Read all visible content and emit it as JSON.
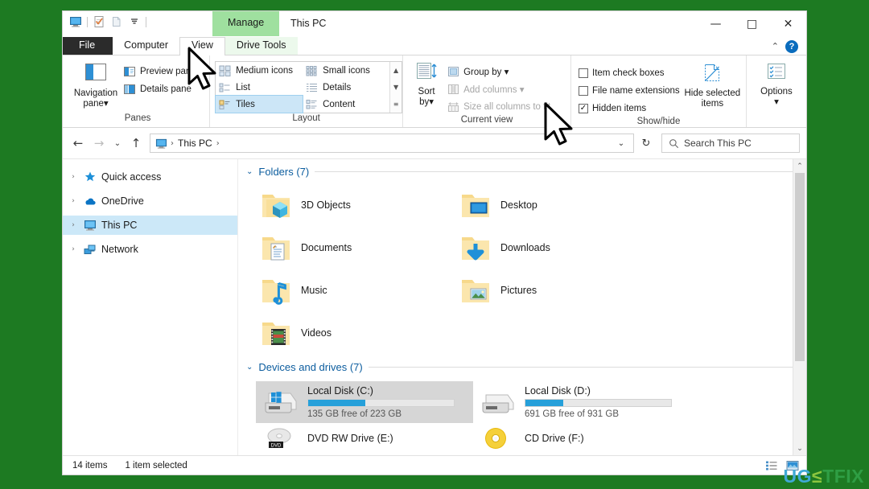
{
  "window": {
    "title": "This PC",
    "contextual_tab_title": "Manage",
    "controls": {
      "minimize": "—",
      "maximize": "□",
      "close": "✕"
    },
    "ribbon_collapse": "⌃",
    "help": "?"
  },
  "quick_access_toolbar": [
    {
      "name": "this-pc-icon"
    },
    {
      "name": "properties-icon"
    },
    {
      "name": "new-folder-icon"
    },
    {
      "name": "customize-dropdown-icon",
      "glyph": "☰"
    }
  ],
  "tabs": [
    {
      "id": "file",
      "label": "File"
    },
    {
      "id": "computer",
      "label": "Computer"
    },
    {
      "id": "view",
      "label": "View",
      "active": true
    },
    {
      "id": "drive-tools",
      "label": "Drive Tools",
      "contextual": true
    }
  ],
  "ribbon": {
    "groups": [
      {
        "id": "panes",
        "label": "Panes",
        "big_button": {
          "label_line1": "Navigation",
          "label_line2": "pane",
          "dropdown": "▾"
        },
        "items": [
          {
            "label": "Preview pane"
          },
          {
            "label": "Details pane"
          }
        ]
      },
      {
        "id": "layout",
        "label": "Layout",
        "gallery": [
          {
            "label": "Medium icons",
            "selected": false
          },
          {
            "label": "Small icons",
            "selected": false
          },
          {
            "label": "List",
            "selected": false
          },
          {
            "label": "Details",
            "selected": false
          },
          {
            "label": "Tiles",
            "selected": true
          },
          {
            "label": "Content",
            "selected": false
          }
        ],
        "scroll": {
          "up": "▲",
          "down": "▼",
          "more": "≡"
        }
      },
      {
        "id": "current-view",
        "label": "Current view",
        "items": [
          {
            "label": "Group by",
            "dropdown": "▾",
            "disabled": false
          },
          {
            "label": "Add columns",
            "dropdown": "▾",
            "disabled": true
          },
          {
            "label": "Size all columns to fit",
            "disabled": true
          }
        ],
        "sort_button": {
          "line1": "Sort",
          "line2": "by",
          "dropdown": "▾"
        }
      },
      {
        "id": "show-hide",
        "label": "Show/hide",
        "checkboxes": [
          {
            "label": "Item check boxes",
            "checked": false
          },
          {
            "label": "File name extensions",
            "checked": false
          },
          {
            "label": "Hidden items",
            "checked": true
          }
        ],
        "hide_selected": {
          "line1": "Hide selected",
          "line2": "items"
        }
      },
      {
        "id": "options",
        "label": "",
        "options_button": {
          "label": "Options",
          "dropdown": "▾"
        }
      }
    ]
  },
  "addressbar": {
    "back": "←",
    "forward": "→",
    "recent": "⌄",
    "up": "↑",
    "breadcrumbs": [
      "This PC"
    ],
    "separator": "›",
    "dropdown": "⌄",
    "refresh": "↻",
    "search_placeholder": "Search This PC",
    "search_value": ""
  },
  "navigation_pane": {
    "items": [
      {
        "label": "Quick access",
        "icon": "star-icon",
        "selected": false
      },
      {
        "label": "OneDrive",
        "icon": "cloud-icon",
        "selected": false
      },
      {
        "label": "This PC",
        "icon": "monitor-icon",
        "selected": true
      },
      {
        "label": "Network",
        "icon": "network-icon",
        "selected": false
      }
    ],
    "expander": "›"
  },
  "content": {
    "chevron": "⌄",
    "groups": [
      {
        "id": "folders",
        "title": "Folders (7)",
        "items": [
          {
            "name": "3D Objects",
            "icon": "folder-3d-objects-icon"
          },
          {
            "name": "Desktop",
            "icon": "folder-desktop-icon"
          },
          {
            "name": "Documents",
            "icon": "folder-documents-icon"
          },
          {
            "name": "Downloads",
            "icon": "folder-downloads-icon"
          },
          {
            "name": "Music",
            "icon": "folder-music-icon"
          },
          {
            "name": "Pictures",
            "icon": "folder-pictures-icon"
          },
          {
            "name": "Videos",
            "icon": "folder-videos-icon"
          }
        ]
      },
      {
        "id": "devices-and-drives",
        "title": "Devices and drives (7)",
        "drives": [
          {
            "name": "Local Disk (C:)",
            "free_text": "135 GB free of 223 GB",
            "used_percent": 39,
            "icon": "windows-drive-icon",
            "selected": true
          },
          {
            "name": "Local Disk (D:)",
            "free_text": "691 GB free of 931 GB",
            "used_percent": 26,
            "icon": "hard-drive-icon",
            "selected": false
          }
        ],
        "optical": [
          {
            "name": "DVD RW Drive (E:)",
            "icon": "dvd-rw-drive-icon"
          },
          {
            "name": "CD Drive (F:)",
            "icon": "cd-drive-icon"
          }
        ]
      }
    ],
    "scrollbar": {
      "up": "⌃",
      "down": "⌄",
      "thumb_percent": 70
    }
  },
  "statusbar": {
    "item_count": "14 items",
    "selection": "1 item selected",
    "details_view_icon": "details-view-icon",
    "large_icons_view_icon": "large-icons-view-icon"
  },
  "watermark": {
    "part1": "UG",
    "part2": "≤",
    "part3": "TFIX"
  },
  "colors": {
    "accent_blue": "#26a0da",
    "selection_blue": "#cce8f8",
    "contextual_green": "#9fe09f",
    "desktop_green": "#1d7a22",
    "link_blue": "#0b5c9e"
  }
}
